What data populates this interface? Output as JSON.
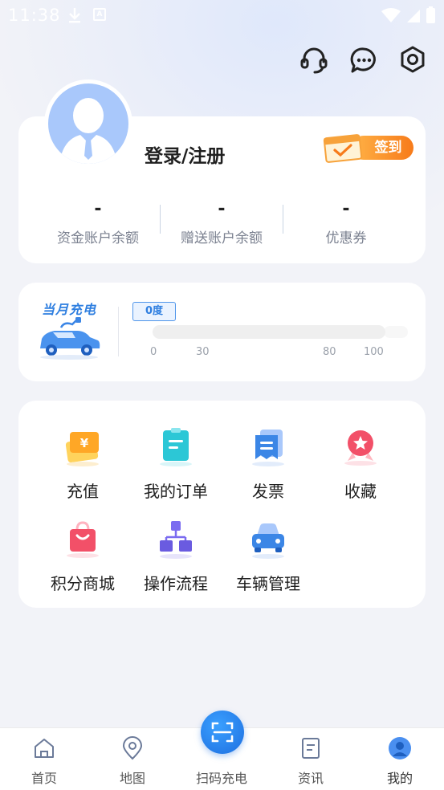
{
  "status_bar": {
    "time": "11:38",
    "a_icon": "A"
  },
  "top_icons": [
    "headset-icon",
    "message-icon",
    "settings-icon"
  ],
  "profile": {
    "login_label": "登录/注册",
    "signin_label": "签到",
    "stats": [
      {
        "value": "-",
        "label": "资金账户余额"
      },
      {
        "value": "-",
        "label": "赠送账户余额"
      },
      {
        "value": "-",
        "label": "优惠券"
      }
    ]
  },
  "charging": {
    "title": "当月充电",
    "badge": "0度",
    "progress": 0,
    "ticks": [
      "0",
      "30",
      "80",
      "100"
    ]
  },
  "features": [
    {
      "label": "充值",
      "icon": "recharge-icon"
    },
    {
      "label": "我的订单",
      "icon": "order-icon"
    },
    {
      "label": "发票",
      "icon": "invoice-icon"
    },
    {
      "label": "收藏",
      "icon": "favorite-icon"
    },
    {
      "label": "积分商城",
      "icon": "points-mall-icon"
    },
    {
      "label": "操作流程",
      "icon": "process-icon"
    },
    {
      "label": "车辆管理",
      "icon": "vehicle-icon"
    }
  ],
  "nav": {
    "items": [
      {
        "label": "首页",
        "icon": "home-icon"
      },
      {
        "label": "地图",
        "icon": "map-pin-icon"
      },
      {
        "label": "扫码充电",
        "icon": "scan-icon"
      },
      {
        "label": "资讯",
        "icon": "news-icon"
      },
      {
        "label": "我的",
        "icon": "profile-icon"
      }
    ],
    "active_index": 4
  },
  "colors": {
    "accent": "#2f7fe0",
    "signin": "#f77b1a",
    "background": "#f2f3f8"
  }
}
